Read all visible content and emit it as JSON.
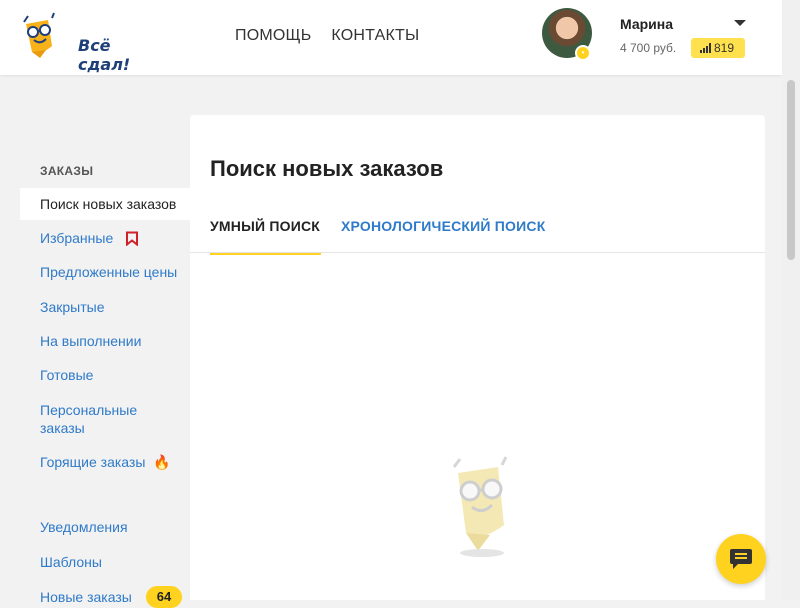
{
  "header": {
    "logo_text": "Всё сдал!",
    "nav": [
      {
        "label": "ПОМОЩЬ"
      },
      {
        "label": "КОНТАКТЫ"
      }
    ],
    "user": {
      "name": "Марина",
      "balance": "4 700 руб.",
      "rating": "819"
    }
  },
  "sidebar": {
    "heading": "ЗАКАЗЫ",
    "items": [
      {
        "label": "Поиск новых заказов"
      },
      {
        "label": "Избранные"
      },
      {
        "label": "Предложенные цены"
      },
      {
        "label": "Закрытые"
      },
      {
        "label": "На выполнении"
      },
      {
        "label": "Готовые"
      },
      {
        "label": "Персональные заказы"
      },
      {
        "label": "Горящие заказы"
      },
      {
        "label": "Уведомления"
      },
      {
        "label": "Шаблоны"
      },
      {
        "label": "Новые заказы",
        "badge": "64"
      }
    ]
  },
  "main": {
    "title": "Поиск новых заказов",
    "tabs": [
      {
        "label": "УМНЫЙ ПОИСК"
      },
      {
        "label": "ХРОНОЛОГИЧЕСКИЙ ПОИСК"
      }
    ]
  },
  "colors": {
    "accent_yellow": "#ffd21f",
    "link_blue": "#2f7ac9",
    "favorites_icon_red": "#d0202a"
  },
  "icons": [
    "logo-mascot-icon",
    "chevron-down-icon",
    "rating-bars-icon",
    "bookmark-icon",
    "fire-icon",
    "mascot-placeholder-icon",
    "chat-icon"
  ]
}
